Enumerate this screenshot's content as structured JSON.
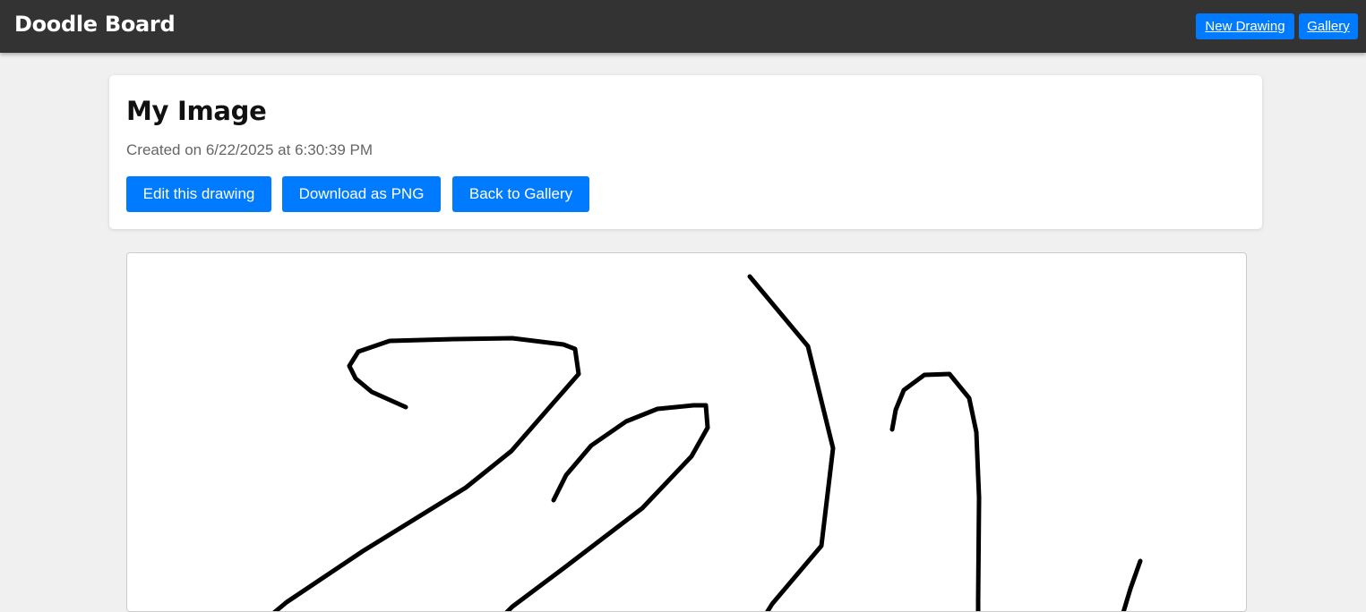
{
  "header": {
    "brand": "Doodle Board",
    "nav": {
      "new_drawing": "New Drawing",
      "gallery": "Gallery"
    }
  },
  "drawing": {
    "title": "My Image",
    "created": "Created on 6/22/2025 at 6:30:39 PM",
    "actions": {
      "edit": "Edit this drawing",
      "download": "Download as PNG",
      "back": "Back to Gallery"
    }
  },
  "colors": {
    "accent": "#007bff",
    "header_bg": "#333333",
    "page_bg": "#f0f0f0",
    "stroke": "#000000"
  }
}
